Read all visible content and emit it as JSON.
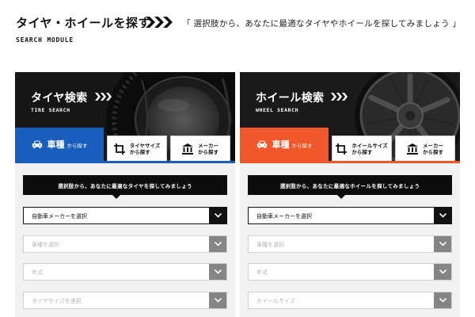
{
  "header": {
    "title": "タイヤ・ホイールを探す",
    "subtitle": "SEARCH MODULE",
    "description": "「 選択肢から、あなたに最適なタイヤやホイールを探してみましょう 」"
  },
  "colors": {
    "tire_accent": "#1a5ebd",
    "wheel_accent": "#f0582b",
    "dark": "#0d0d0d"
  },
  "tire_panel": {
    "title": "タイヤ検索",
    "subtitle": "TIRE SEARCH",
    "tabs": [
      {
        "main": "車種",
        "small": "から探す",
        "icon": "car-icon"
      },
      {
        "line1": "タイヤサイズ",
        "line2": "から探す",
        "icon": "crop-icon"
      },
      {
        "line1": "メーカー",
        "line2": "から探す",
        "icon": "building-icon"
      }
    ],
    "instruction": "選択肢から、あなたに最適なタイヤを探してみましょう",
    "selects": [
      "自動車メーカーを選択",
      "車種を選択",
      "年式",
      "タイヤサイズを選択"
    ]
  },
  "wheel_panel": {
    "title": "ホイール検索",
    "subtitle": "WHEEL SEARCH",
    "tabs": [
      {
        "main": "車種",
        "small": "から探す",
        "icon": "car-icon"
      },
      {
        "line1": "ホイールサイズ",
        "line2": "から探す",
        "icon": "crop-icon"
      },
      {
        "line1": "メーカー",
        "line2": "から探す",
        "icon": "building-icon"
      }
    ],
    "instruction": "選択肢から、あなたに最適なホイールを探してみましょう",
    "selects": [
      "自動車メーカーを選択",
      "車種を選択",
      "年式",
      "ホイールサイズ"
    ]
  }
}
